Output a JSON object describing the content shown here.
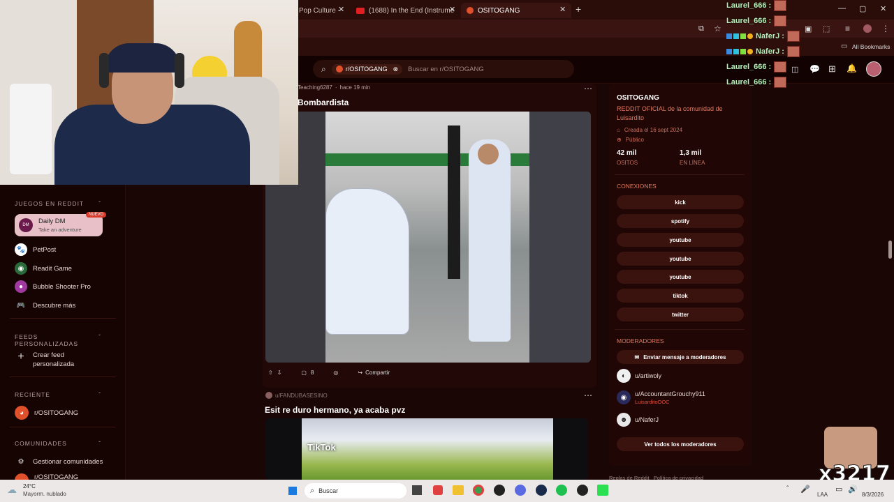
{
  "browser": {
    "tabs": [
      {
        "label": "Pop Culture -"
      },
      {
        "label": "(1688) In the End (Instrume"
      },
      {
        "label": "OSITOGANG"
      }
    ],
    "bookmarks_label": "All Bookmarks"
  },
  "search": {
    "community_chip": "r/OSITOGANG",
    "placeholder": "Buscar en r/OSITOGANG"
  },
  "sidebar": {
    "games_header": "JUEGOS EN REDDIT",
    "daily_dm": {
      "title": "Daily DM",
      "subtitle": "Take an adventure",
      "badge": "NUEVO"
    },
    "games": [
      {
        "label": "PetPost"
      },
      {
        "label": "Readit Game"
      },
      {
        "label": "Bubble Shooter Pro"
      },
      {
        "label": "Descubre más"
      }
    ],
    "custom_feeds_header": "FEEDS PERSONALIZADAS",
    "create_feed": "Crear feed personalizada",
    "recent_header": "RECIENTE",
    "recent_item": "r/OSITOGANG",
    "communities_header": "COMUNIDADES",
    "manage_communities": "Gestionar comunidades",
    "partial_item": "r/OSITOGANG"
  },
  "post1": {
    "author": "Teaching6287",
    "time": "hace 19 min",
    "title": "Bombardista",
    "comments": "8",
    "share": "Compartir"
  },
  "post2": {
    "author": "u/FANDUBASESINO",
    "title": "Esit re duro hermano, ya acaba pvz",
    "video_watermark": "TikTok"
  },
  "community": {
    "name": "OSITOGANG",
    "description": "REDDIT OFICIAL de la comunidad de Luisardito",
    "created": "Creada el 16 sept 2024",
    "visibility": "Público",
    "members_count": "42 mil",
    "members_label": "OSITOS",
    "online_count": "1,3 mil",
    "online_label": "EN LÍNEA",
    "connections_header": "CONEXIONES",
    "connections": [
      "kick",
      "spotify",
      "youtube",
      "youtube",
      "youtube",
      "tiktok",
      "twitter"
    ],
    "moderators_header": "MODERADORES",
    "message_mods": "Enviar mensaje a moderadores",
    "moderators": [
      {
        "name": "u/artiwoly",
        "flair": ""
      },
      {
        "name": "u/AccountantGrouchy911",
        "flair": "LuisarditoOOC"
      },
      {
        "name": "u/NaferJ",
        "flair": ""
      }
    ],
    "view_all_mods": "Ver todos los moderadores",
    "footer": "Reglas de Reddit   Política de privacidad"
  },
  "chat": [
    {
      "user": "Laurel_666 :"
    },
    {
      "user": "Laurel_666 :"
    },
    {
      "user": "NaferJ :"
    },
    {
      "user": "NaferJ :"
    },
    {
      "user": "Laurel_666 :"
    },
    {
      "user": "Laurel_666 :"
    }
  ],
  "overlay": {
    "combo": "x3217"
  },
  "taskbar": {
    "weather_temp": "24°C",
    "weather_desc": "Mayorm. nublado",
    "search_label": "Buscar",
    "lang": "LAA",
    "date": "8/3/2026"
  },
  "colors": {
    "accent": "#e0502a",
    "chat_name": "#b8f0b8",
    "link": "#e07a60"
  }
}
